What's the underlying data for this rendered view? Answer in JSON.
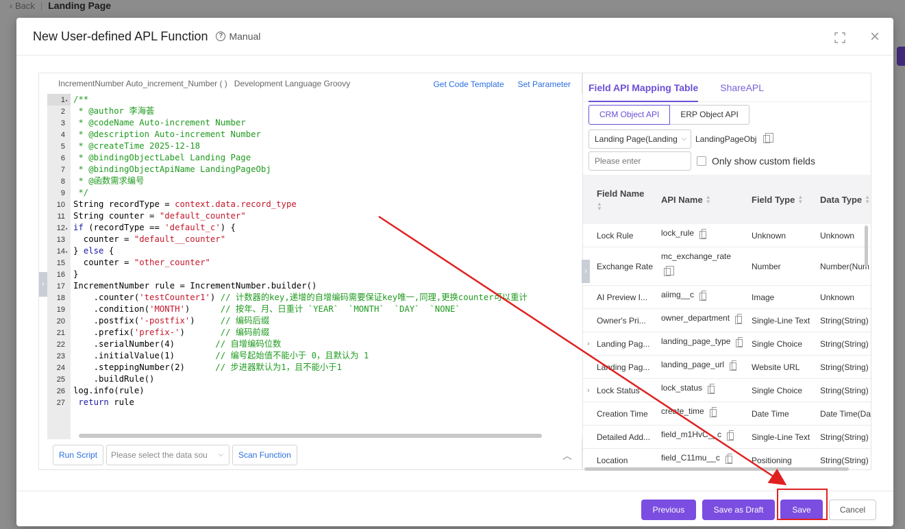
{
  "background": {
    "back_label": "Back",
    "page_title": "Landing Page"
  },
  "modal": {
    "title": "New User-defined APL Function",
    "manual_label": "Manual"
  },
  "editor": {
    "function_info": "IncrementNumber Auto_increment_Number ( )",
    "language_info": "Development Language Groovy",
    "get_template_label": "Get Code Template",
    "set_parameter_label": "Set Parameter",
    "lines": [
      {
        "n": "1",
        "fold": "▾",
        "parts": [
          {
            "t": "/**",
            "c": "c-cm"
          }
        ]
      },
      {
        "n": "2",
        "fold": "",
        "parts": [
          {
            "t": " * @author 李海荟",
            "c": "c-cm"
          }
        ]
      },
      {
        "n": "3",
        "fold": "",
        "parts": [
          {
            "t": " * @codeName Auto-increment Number",
            "c": "c-cm"
          }
        ]
      },
      {
        "n": "4",
        "fold": "",
        "parts": [
          {
            "t": " * @description Auto-increment Number",
            "c": "c-cm"
          }
        ]
      },
      {
        "n": "5",
        "fold": "",
        "parts": [
          {
            "t": " * @createTime 2025-12-18",
            "c": "c-cm"
          }
        ]
      },
      {
        "n": "6",
        "fold": "",
        "parts": [
          {
            "t": " * @bindingObjectLabel Landing Page",
            "c": "c-cm"
          }
        ]
      },
      {
        "n": "7",
        "fold": "",
        "parts": [
          {
            "t": " * @bindingObjectApiName LandingPageObj",
            "c": "c-cm"
          }
        ]
      },
      {
        "n": "8",
        "fold": "",
        "parts": [
          {
            "t": " * @函数需求编号",
            "c": "c-cm"
          }
        ]
      },
      {
        "n": "9",
        "fold": "",
        "parts": [
          {
            "t": " */",
            "c": "c-cm"
          }
        ]
      },
      {
        "n": "10",
        "fold": "",
        "parts": [
          {
            "t": "String recordType = ",
            "c": "c-pl"
          },
          {
            "t": "context.data.record_type",
            "c": "c-str"
          }
        ]
      },
      {
        "n": "11",
        "fold": "",
        "parts": [
          {
            "t": "String counter = ",
            "c": "c-pl"
          },
          {
            "t": "\"default_counter\"",
            "c": "c-str"
          }
        ]
      },
      {
        "n": "12",
        "fold": "▾",
        "parts": [
          {
            "t": "if",
            "c": "c-kw"
          },
          {
            "t": " (recordType == ",
            "c": "c-pl"
          },
          {
            "t": "'default_c'",
            "c": "c-str"
          },
          {
            "t": ") {",
            "c": "c-pl"
          }
        ]
      },
      {
        "n": "13",
        "fold": "",
        "parts": [
          {
            "t": "  counter = ",
            "c": "c-pl"
          },
          {
            "t": "\"default__counter\"",
            "c": "c-str"
          }
        ]
      },
      {
        "n": "14",
        "fold": "▾",
        "parts": [
          {
            "t": "} ",
            "c": "c-pl"
          },
          {
            "t": "else",
            "c": "c-kw"
          },
          {
            "t": " {",
            "c": "c-pl"
          }
        ]
      },
      {
        "n": "15",
        "fold": "",
        "parts": [
          {
            "t": "  counter = ",
            "c": "c-pl"
          },
          {
            "t": "\"other_counter\"",
            "c": "c-str"
          }
        ]
      },
      {
        "n": "16",
        "fold": "",
        "parts": [
          {
            "t": "}",
            "c": "c-pl"
          }
        ]
      },
      {
        "n": "17",
        "fold": "",
        "parts": [
          {
            "t": "IncrementNumber rule = IncrementNumber.builder()",
            "c": "c-pl"
          }
        ]
      },
      {
        "n": "18",
        "fold": "",
        "parts": [
          {
            "t": "    .counter(",
            "c": "c-pl"
          },
          {
            "t": "'testCounter1'",
            "c": "c-str"
          },
          {
            "t": ") ",
            "c": "c-pl"
          },
          {
            "t": "// 计数器的key,递增的自增编码需要保证key唯一,同理,更换counter可以重计",
            "c": "c-cm"
          }
        ]
      },
      {
        "n": "19",
        "fold": "",
        "parts": [
          {
            "t": "    .condition(",
            "c": "c-pl"
          },
          {
            "t": "'MONTH'",
            "c": "c-str"
          },
          {
            "t": ")      ",
            "c": "c-pl"
          },
          {
            "t": "// 按年、月、日重计 `YEAR`  `MONTH`  `DAY`  `NONE`",
            "c": "c-cm"
          }
        ]
      },
      {
        "n": "20",
        "fold": "",
        "parts": [
          {
            "t": "    .postfix(",
            "c": "c-pl"
          },
          {
            "t": "'-postfix'",
            "c": "c-str"
          },
          {
            "t": ")     ",
            "c": "c-pl"
          },
          {
            "t": "// 编码后缀",
            "c": "c-cm"
          }
        ]
      },
      {
        "n": "21",
        "fold": "",
        "parts": [
          {
            "t": "    .prefix(",
            "c": "c-pl"
          },
          {
            "t": "'prefix-'",
            "c": "c-str"
          },
          {
            "t": ")       ",
            "c": "c-pl"
          },
          {
            "t": "// 编码前缀",
            "c": "c-cm"
          }
        ]
      },
      {
        "n": "22",
        "fold": "",
        "parts": [
          {
            "t": "    .serialNumber(4)        ",
            "c": "c-pl"
          },
          {
            "t": "// 自增编码位数",
            "c": "c-cm"
          }
        ]
      },
      {
        "n": "23",
        "fold": "",
        "parts": [
          {
            "t": "    .initialValue(1)        ",
            "c": "c-pl"
          },
          {
            "t": "// 编号起始值不能小于 0，且默认为 1",
            "c": "c-cm"
          }
        ]
      },
      {
        "n": "24",
        "fold": "",
        "parts": [
          {
            "t": "    .steppingNumber(2)      ",
            "c": "c-pl"
          },
          {
            "t": "// 步进器默认为1，且不能小于1",
            "c": "c-cm"
          }
        ]
      },
      {
        "n": "25",
        "fold": "",
        "parts": [
          {
            "t": "    .buildRule()",
            "c": "c-pl"
          }
        ]
      },
      {
        "n": "26",
        "fold": "",
        "parts": [
          {
            "t": "log.info(rule)",
            "c": "c-pl"
          }
        ]
      },
      {
        "n": "27",
        "fold": "",
        "parts": [
          {
            "t": " return",
            "c": "c-kw"
          },
          {
            "t": " rule",
            "c": "c-pl"
          }
        ]
      }
    ],
    "run_script_label": "Run Script",
    "data_source_placeholder": "Please select the data sou",
    "scan_function_label": "Scan Function"
  },
  "right_panel": {
    "tabs": [
      "Field API Mapping Table",
      "ShareAPL"
    ],
    "seg": [
      "CRM Object API",
      "ERP Object API"
    ],
    "object_select": "Landing Page(Landing",
    "object_api": "LandingPageObj",
    "search_placeholder": "Please enter",
    "custom_only_label": "Only show custom fields",
    "columns": [
      "Field Name",
      "API Name",
      "Field Type",
      "Data Type"
    ],
    "rows": [
      {
        "name": "Lock Rule",
        "api": "lock_rule",
        "type": "Unknown",
        "dtype": "Unknown",
        "expand": false,
        "tall": false
      },
      {
        "name": "Exchange Rate",
        "api": "mc_exchange_rate",
        "type": "Number",
        "dtype": "Number(Num",
        "expand": false,
        "tall": true
      },
      {
        "name": "AI Preview I...",
        "api": "aiimg__c",
        "type": "Image",
        "dtype": "Unknown",
        "expand": false,
        "tall": false
      },
      {
        "name": "Owner's Pri...",
        "api": "owner_department",
        "type": "Single-Line Text",
        "dtype": "String(String)",
        "expand": false,
        "tall": false
      },
      {
        "name": "Landing Pag...",
        "api": "landing_page_type",
        "type": "Single Choice",
        "dtype": "String(String)",
        "expand": true,
        "tall": false
      },
      {
        "name": "Landing Pag...",
        "api": "landing_page_url",
        "type": "Website URL",
        "dtype": "String(String)",
        "expand": false,
        "tall": false
      },
      {
        "name": "Lock Status",
        "api": "lock_status",
        "type": "Single Choice",
        "dtype": "String(String)",
        "expand": true,
        "tall": false
      },
      {
        "name": "Creation Time",
        "api": "create_time",
        "type": "Date Time",
        "dtype": "Date Time(Da",
        "expand": false,
        "tall": false
      },
      {
        "name": "Detailed Add...",
        "api": "field_m1HvC__c",
        "type": "Single-Line Text",
        "dtype": "String(String)",
        "expand": false,
        "tall": false
      },
      {
        "name": "Location",
        "api": "field_C11mu__c",
        "type": "Positioning",
        "dtype": "String(String)",
        "expand": false,
        "tall": false
      }
    ]
  },
  "footer": {
    "previous_label": "Previous",
    "save_draft_label": "Save as Draft",
    "save_label": "Save",
    "cancel_label": "Cancel"
  },
  "colors": {
    "primary": "#7b4de0",
    "link": "#2a6ee0",
    "annotation": "#e02020"
  }
}
